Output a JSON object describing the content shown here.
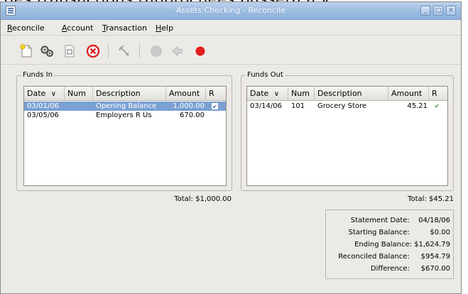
{
  "caption": "des transactions rapprochées passera à y.",
  "window": {
    "title": "Assets:Checking - Reconcile"
  },
  "window_buttons": {
    "minimize": "_",
    "maximize": "□",
    "close": "✕"
  },
  "menu": [
    {
      "label": "Reconcile",
      "mnemonic": "R"
    },
    {
      "label": "Account",
      "mnemonic": "A"
    },
    {
      "label": "Transaction",
      "mnemonic": "T"
    },
    {
      "label": "Help",
      "mnemonic": "H"
    }
  ],
  "toolbar": {
    "icons": [
      "new-transaction-icon",
      "transfer-icon",
      "edit-icon",
      "delete-icon",
      "open-account-icon",
      "balance-icon",
      "postpone-icon",
      "finish-icon"
    ]
  },
  "funds_in": {
    "label": "Funds In",
    "columns": [
      "Date",
      "Num",
      "Description",
      "Amount",
      "R"
    ],
    "sort_indicator": "∨",
    "rows": [
      {
        "date": "03/01/06",
        "num": "",
        "description": "Opening Balance",
        "amount": "1,000.00",
        "reconciled": "✔",
        "selected": true
      },
      {
        "date": "03/05/06",
        "num": "",
        "description": "Employers R Us",
        "amount": "670.00",
        "reconciled": "",
        "selected": false
      }
    ],
    "total": "Total: $1,000.00"
  },
  "funds_out": {
    "label": "Funds Out",
    "columns": [
      "Date",
      "Num",
      "Description",
      "Amount",
      "R"
    ],
    "sort_indicator": "∨",
    "rows": [
      {
        "date": "03/14/06",
        "num": "101",
        "description": "Grocery Store",
        "amount": "45.21",
        "reconciled": "✔",
        "selected": false
      }
    ],
    "total": "Total: $45.21"
  },
  "summary": [
    {
      "label": "Statement Date:",
      "value": "04/18/06"
    },
    {
      "label": "Starting Balance:",
      "value": "$0.00"
    },
    {
      "label": "Ending Balance:",
      "value": "$1,624.79"
    },
    {
      "label": "Reconciled Balance:",
      "value": "$954.79"
    },
    {
      "label": "Difference:",
      "value": "$670.00"
    }
  ],
  "colors": {
    "title_gradient_top": "#bcd2ec",
    "title_gradient_bottom": "#8fb2db",
    "selection": "#7aa1d2",
    "reconciled_check": "#2f8f2f",
    "delete_red": "#d92323",
    "finish_red": "#e41b1b"
  }
}
